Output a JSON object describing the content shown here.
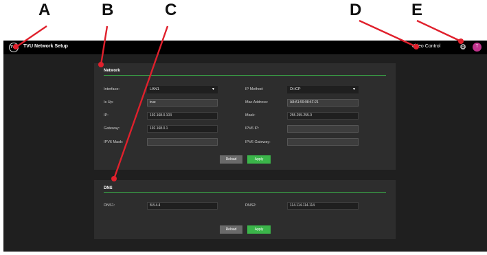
{
  "callouts": [
    "A",
    "B",
    "C",
    "D",
    "E"
  ],
  "header": {
    "logo_text": "TVU",
    "title": "TVU Network Setup",
    "video_control": "Video Control",
    "gear_icon": "gear-icon",
    "avatar_initial": "T",
    "avatar_color": "#c0338c"
  },
  "network": {
    "title": "Network",
    "interface_label": "Interface:",
    "interface_value": "LAN1",
    "ip_method_label": "IP Method:",
    "ip_method_value": "DHCP",
    "is_up_label": "Is Up:",
    "is_up_value": "true",
    "mac_label": "Mac Address:",
    "mac_value": "A8:A1:59:98:4F:21",
    "ip_label": "IP:",
    "ip_value": "192.168.0.103",
    "mask_label": "Mask:",
    "mask_value": "255.255.255.0",
    "gateway_label": "Gateway:",
    "gateway_value": "192.168.0.1",
    "ipv6_ip_label": "IPV6 IP:",
    "ipv6_ip_value": "",
    "ipv6_mask_label": "IPV6 Mask:",
    "ipv6_mask_value": "",
    "ipv6_gateway_label": "IPV6 Gateway:",
    "ipv6_gateway_value": "",
    "reload_label": "Reload",
    "apply_label": "Apply"
  },
  "dns": {
    "title": "DNS",
    "dns1_label": "DNS1:",
    "dns1_value": "8.8.4.4",
    "dns2_label": "DNS2:",
    "dns2_value": "114.114.114.114",
    "reload_label": "Reload",
    "apply_label": "Apply"
  },
  "colors": {
    "accent_green": "#3bb54a",
    "marker_red": "#e0202c",
    "panel_bg": "#2d2d2d",
    "page_bg": "#1f1f1f"
  }
}
